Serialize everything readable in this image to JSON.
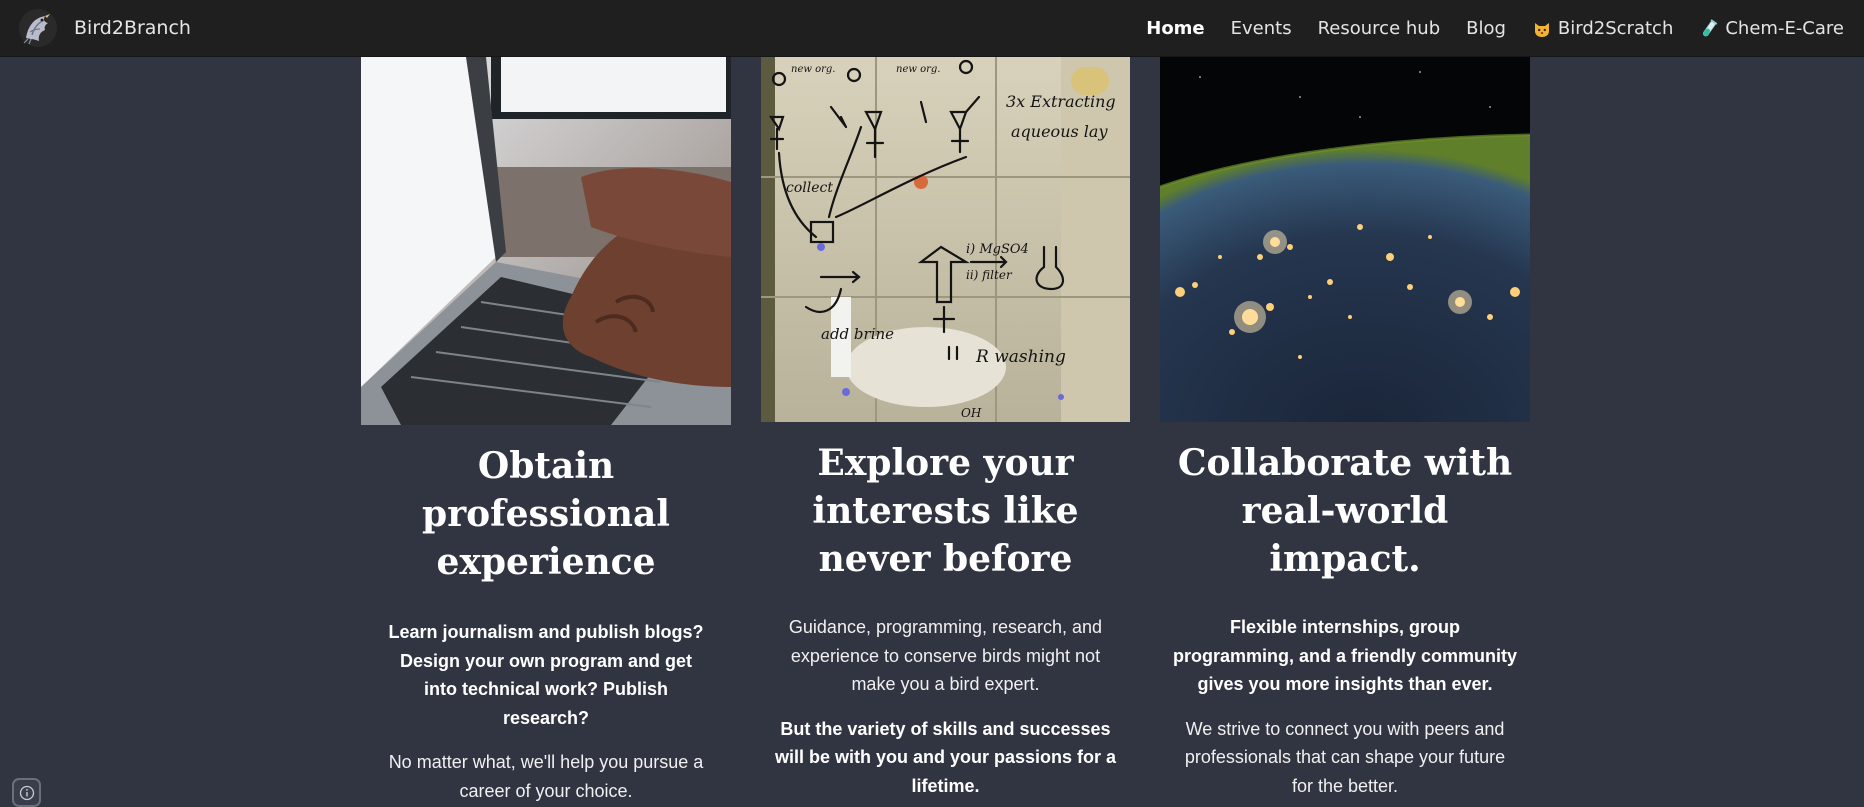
{
  "navbar": {
    "brand_name": "Bird2Branch",
    "logo_icon": "bird-logo-icon",
    "items": [
      {
        "label": "Home",
        "active": true
      },
      {
        "label": "Events",
        "active": false
      },
      {
        "label": "Resource hub",
        "active": false
      },
      {
        "label": "Blog",
        "active": false
      },
      {
        "label": "Bird2Scratch",
        "icon": "cat-face-icon",
        "active": false
      },
      {
        "label": "Chem-E-Care",
        "icon": "test-tube-icon",
        "active": false
      }
    ]
  },
  "cards": [
    {
      "image": "laptop-typing-photo",
      "title": "Obtain professional experience",
      "paragraphs": [
        {
          "text": "Learn journalism and publish blogs? Design your own program and get into technical work? Publish research?",
          "bold": true
        },
        {
          "text": "No matter what, we'll help you pursue a career of your choice.",
          "bold": false
        }
      ]
    },
    {
      "image": "lab-glass-notes-photo",
      "title": "Explore your interests like never before",
      "paragraphs": [
        {
          "text": "Guidance, programming, research, and experience to conserve birds might not make you a bird expert.",
          "bold": false
        },
        {
          "text": "But the variety of skills and successes will be with you and your passions for a lifetime.",
          "bold": true
        }
      ]
    },
    {
      "image": "earth-night-lights-photo",
      "title": "Collaborate with real-world impact.",
      "paragraphs": [
        {
          "text": "Flexible internships, group programming, and a friendly community gives you more insights than ever.",
          "bold": true
        },
        {
          "text": "We  strive to connect you with peers and professionals that can shape your future for the better.",
          "bold": false
        }
      ]
    }
  ],
  "colors": {
    "background": "#313542",
    "navbar": "#1f1f1f",
    "text": "#ffffff"
  },
  "info_button": {
    "icon": "info-icon"
  }
}
